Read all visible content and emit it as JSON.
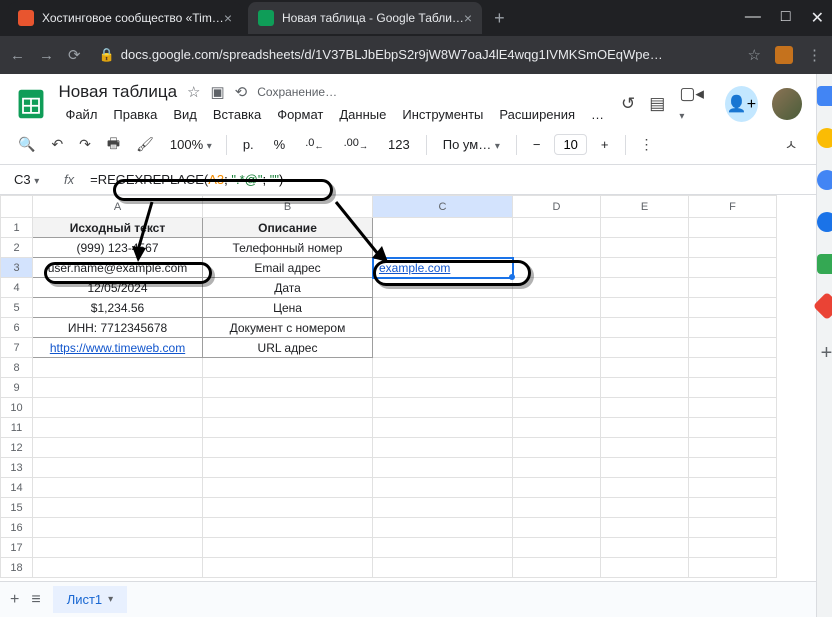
{
  "browser": {
    "tab1": "Хостинговое сообщество «Tim…",
    "tab2": "Новая таблица - Google Табли…",
    "url": "docs.google.com/spreadsheets/d/1V37BLJbEbpS2r9jW8W7oaJ4lE4wqg1IVMKSmOEqWpe…"
  },
  "doc": {
    "title": "Новая таблица",
    "saving": "Сохранение…"
  },
  "menu": {
    "file": "Файл",
    "edit": "Правка",
    "view": "Вид",
    "insert": "Вставка",
    "format": "Формат",
    "data": "Данные",
    "tools": "Инструменты",
    "ext": "Расширения",
    "more": "…"
  },
  "toolbar": {
    "zoom": "100%",
    "curr": "р.",
    "pct": "%",
    "dec0": ".0",
    "dec00": ".00",
    "num": "123",
    "font": "По ум…",
    "size": "10",
    "minus": "−",
    "plus": "+"
  },
  "formula": {
    "cell": "C3",
    "fn": "=REGEXREPLACE(",
    "ref": "A3",
    "sep1": "; ",
    "s1": "\".*@\"",
    "sep2": "; ",
    "s2": "\"\"",
    "end": ")"
  },
  "cols": {
    "A": "A",
    "B": "B",
    "C": "C",
    "D": "D",
    "E": "E",
    "F": "F"
  },
  "rows": [
    "1",
    "2",
    "3",
    "4",
    "5",
    "6",
    "7",
    "8",
    "9",
    "10",
    "11",
    "12",
    "13",
    "14",
    "15",
    "16",
    "17",
    "18"
  ],
  "cells": {
    "A1": "Исходный текст",
    "B1": "Описание",
    "A2": "(999) 123-4567",
    "B2": "Телефонный номер",
    "A3": "user.name@example.com",
    "B3": "Email адрес",
    "C3": "example.com",
    "A4": "12/05/2024",
    "B4": "Дата",
    "A5": "$1,234.56",
    "B5": "Цена",
    "A6": "ИНН: 7712345678",
    "B6": "Документ с номером",
    "A7": "https://www.timeweb.com",
    "B7": "URL адрес"
  },
  "sheet": {
    "name": "Лист1"
  }
}
